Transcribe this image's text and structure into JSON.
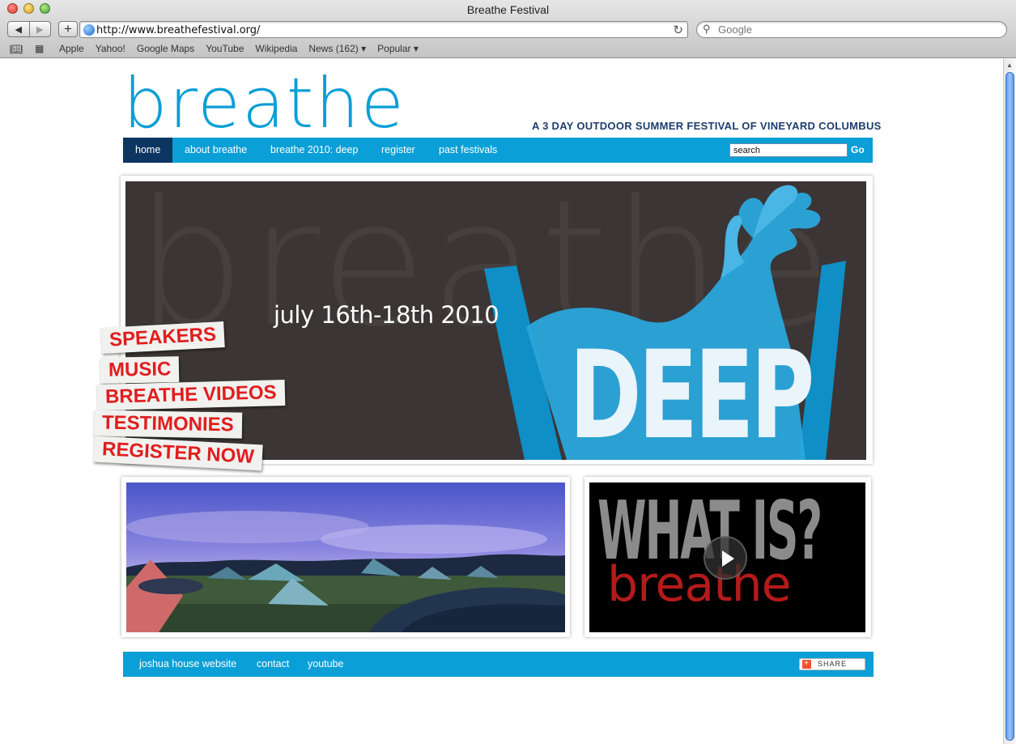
{
  "window": {
    "title": "Breathe Festival"
  },
  "toolbar": {
    "back_label": "◀",
    "forward_label": "▶",
    "add_label": "+",
    "url": "http://www.breathefestival.org/",
    "reload_label": "↻",
    "search_placeholder": "Google"
  },
  "bookmarks": [
    "Apple",
    "Yahoo!",
    "Google Maps",
    "YouTube",
    "Wikipedia",
    "News (162) ▾",
    "Popular ▾"
  ],
  "site": {
    "logo": "breathe",
    "tagline": "A 3 DAY OUTDOOR SUMMER FESTIVAL OF VINEYARD COLUMBUS",
    "nav": [
      "home",
      "about breathe",
      "breathe 2010: deep",
      "register",
      "past festivals"
    ],
    "search_value": "search",
    "go_label": "Go",
    "hero": {
      "date": "july 16th-18th 2010",
      "bg_word": "breathe",
      "deep": "DEEP"
    },
    "tags": [
      "SPEAKERS",
      "MUSIC",
      "BREATHE VIDEOS",
      "TESTIMONIES",
      "REGISTER NOW"
    ],
    "video": {
      "what": "WHAT IS?",
      "word": "breathe"
    },
    "footer_links": [
      "joshua house website",
      "contact",
      "youtube"
    ],
    "share_label": "SHARE"
  },
  "colors": {
    "brand_blue": "#0a9fd6",
    "nav_active": "#0c3561",
    "tag_red": "#e11d1d",
    "hero_bg": "#3b3535"
  }
}
